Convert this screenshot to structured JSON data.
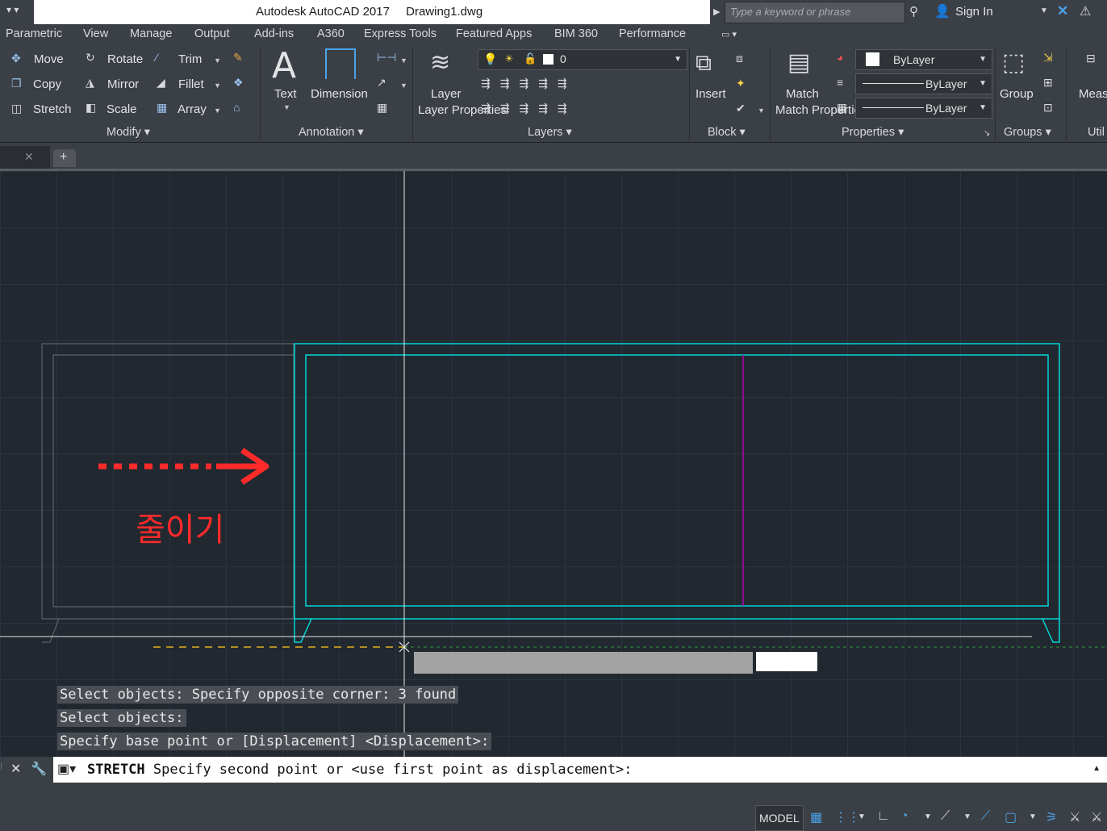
{
  "titlebar": {
    "app": "Autodesk AutoCAD 2017",
    "file": "Drawing1.dwg",
    "search_placeholder": "Type a keyword or phrase",
    "sign_in": "Sign In"
  },
  "menu": [
    "Parametric",
    "View",
    "Manage",
    "Output",
    "Add-ins",
    "A360",
    "Express Tools",
    "Featured Apps",
    "BIM 360",
    "Performance"
  ],
  "ribbon": {
    "modify": {
      "move": "Move",
      "rotate": "Rotate",
      "trim": "Trim",
      "copy": "Copy",
      "mirror": "Mirror",
      "fillet": "Fillet",
      "stretch": "Stretch",
      "scale": "Scale",
      "array": "Array",
      "title": "Modify"
    },
    "annotation": {
      "text": "Text",
      "dimension": "Dimension",
      "title": "Annotation"
    },
    "layers": {
      "layer_properties": "Layer Properties",
      "current_layer": "0",
      "title": "Layers"
    },
    "block": {
      "insert": "Insert",
      "title": "Block"
    },
    "properties": {
      "match": "Match Properties",
      "color": "ByLayer",
      "linetype": "ByLayer",
      "lineweight": "ByLayer",
      "title": "Properties"
    },
    "groups": {
      "group": "Group",
      "title": "Groups"
    },
    "measure": {
      "label": "Meas",
      "title": "Util"
    }
  },
  "drawing": {
    "annotation_text": "줄이기",
    "colors": {
      "selection": "#00d7d9",
      "center_line": "#b000b0",
      "arrow": "#ff2a2a",
      "ghost": "#7a7e84"
    }
  },
  "command": {
    "history": [
      "Select objects: Specify opposite corner: 3 found",
      "Select objects:",
      "Specify base point or [Displacement] <Displacement>:"
    ],
    "name": "STRETCH",
    "prompt": "Specify second point or <use first point as displacement>:"
  },
  "status": {
    "model": "MODEL"
  }
}
